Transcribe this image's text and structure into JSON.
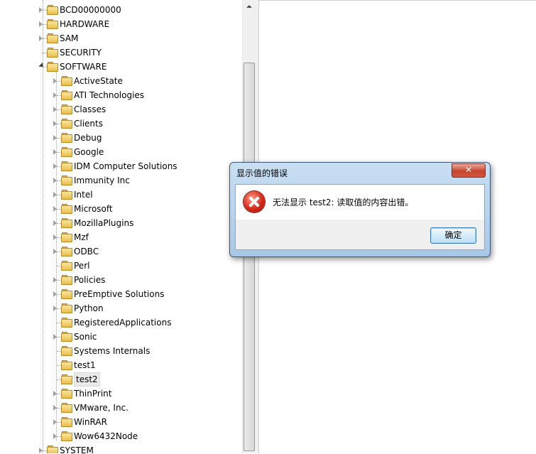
{
  "tree": {
    "root_items": [
      {
        "label": "BCD00000000",
        "expander": "collapsed"
      },
      {
        "label": "HARDWARE",
        "expander": "collapsed"
      },
      {
        "label": "SAM",
        "expander": "collapsed"
      },
      {
        "label": "SECURITY",
        "expander": "none"
      },
      {
        "label": "SOFTWARE",
        "expander": "expanded"
      }
    ],
    "software_children": [
      {
        "label": "ActiveState",
        "expander": "collapsed"
      },
      {
        "label": "ATI Technologies",
        "expander": "collapsed"
      },
      {
        "label": "Classes",
        "expander": "collapsed"
      },
      {
        "label": "Clients",
        "expander": "collapsed"
      },
      {
        "label": "Debug",
        "expander": "collapsed"
      },
      {
        "label": "Google",
        "expander": "collapsed"
      },
      {
        "label": "IDM Computer Solutions",
        "expander": "collapsed"
      },
      {
        "label": "Immunity Inc",
        "expander": "collapsed"
      },
      {
        "label": "Intel",
        "expander": "collapsed"
      },
      {
        "label": "Microsoft",
        "expander": "collapsed"
      },
      {
        "label": "MozillaPlugins",
        "expander": "collapsed"
      },
      {
        "label": "Mzf",
        "expander": "collapsed"
      },
      {
        "label": "ODBC",
        "expander": "collapsed"
      },
      {
        "label": "Perl",
        "expander": "none"
      },
      {
        "label": "Policies",
        "expander": "collapsed"
      },
      {
        "label": "PreEmptive Solutions",
        "expander": "collapsed"
      },
      {
        "label": "Python",
        "expander": "collapsed"
      },
      {
        "label": "RegisteredApplications",
        "expander": "none"
      },
      {
        "label": "Sonic",
        "expander": "collapsed"
      },
      {
        "label": "Systems Internals",
        "expander": "none"
      },
      {
        "label": "test1",
        "expander": "none"
      },
      {
        "label": "test2",
        "expander": "none",
        "selected": true
      },
      {
        "label": "ThinPrint",
        "expander": "collapsed"
      },
      {
        "label": "VMware, Inc.",
        "expander": "collapsed"
      },
      {
        "label": "WinRAR",
        "expander": "collapsed"
      },
      {
        "label": "Wow6432Node",
        "expander": "collapsed"
      }
    ],
    "after_items": [
      {
        "label": "SYSTEM",
        "expander": "collapsed"
      }
    ]
  },
  "dialog": {
    "title": "显示值的错误",
    "close_label": "✕",
    "message": "无法显示 test2: 读取值的内容出错。",
    "ok_label": "确定",
    "icon": "error-icon"
  },
  "colors": {
    "dialog_frame": "#a9c8e6",
    "close_button": "#c6452d",
    "folder": "#e8bf4f",
    "selection": "#eaeaea"
  }
}
